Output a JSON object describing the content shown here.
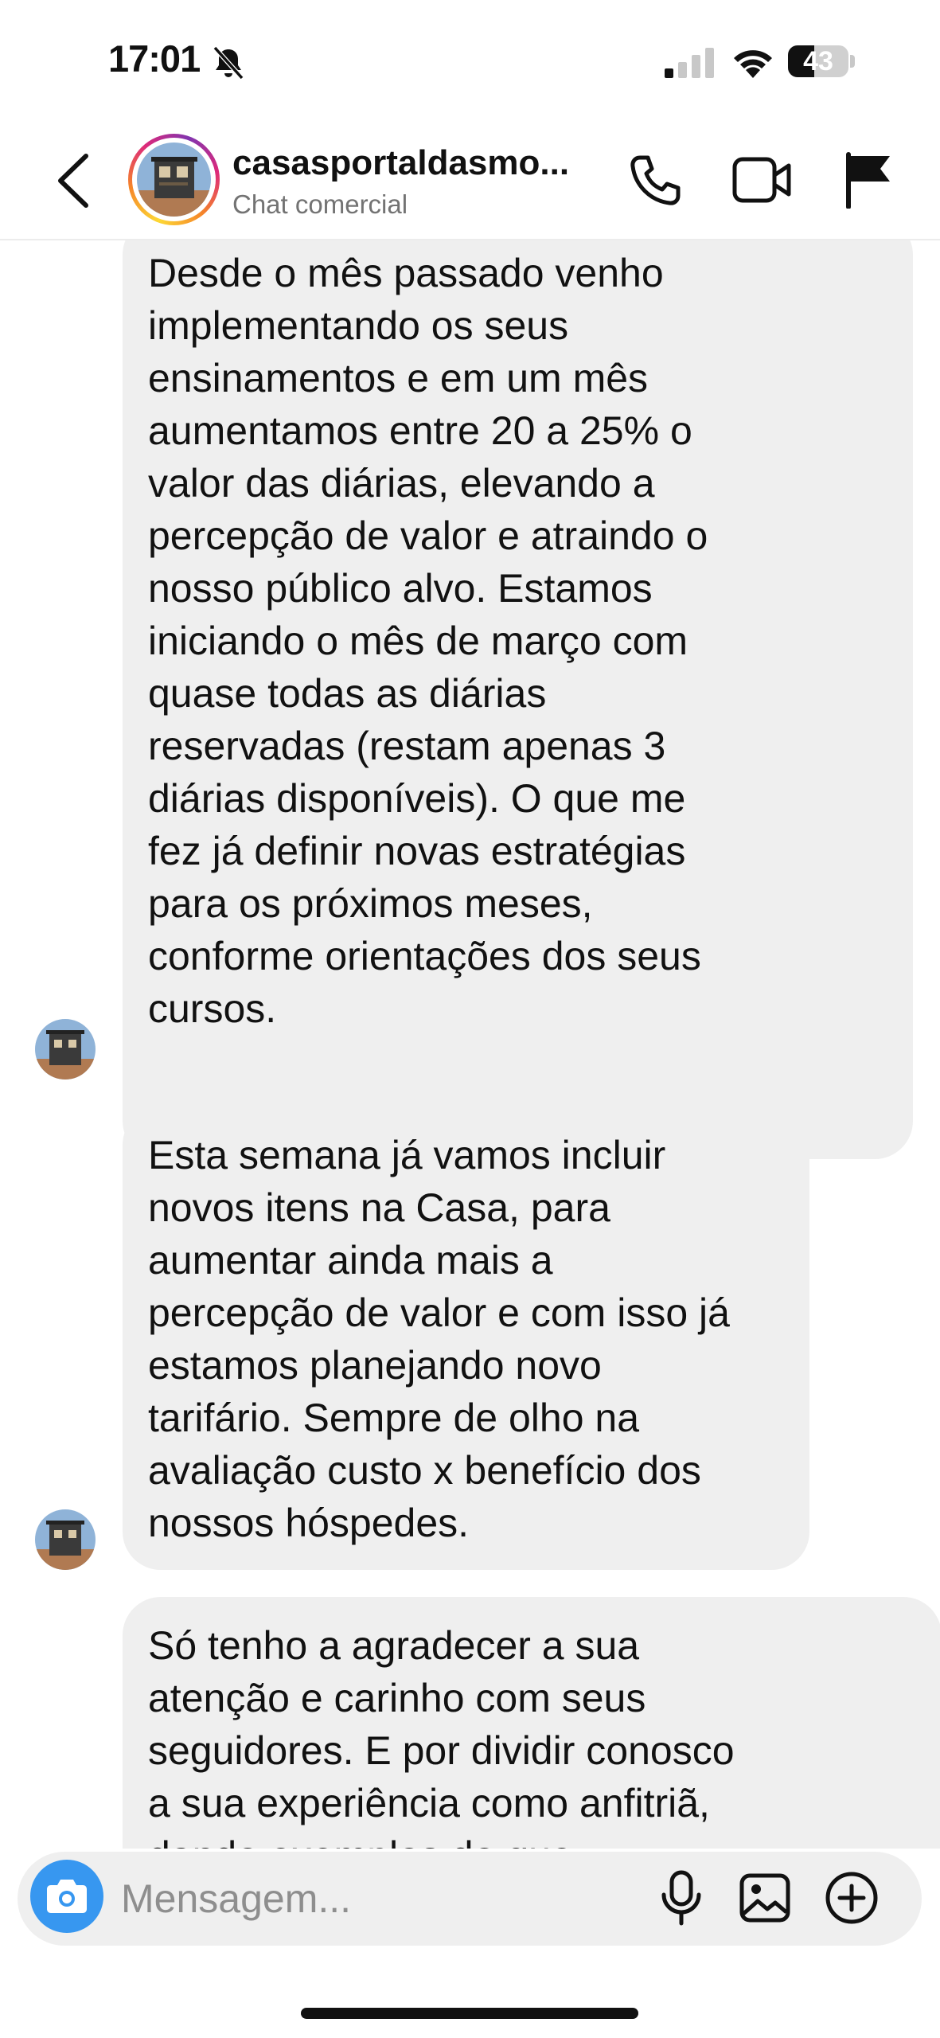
{
  "status_bar": {
    "time": "17:01",
    "battery_percent": 43,
    "battery_label": "43"
  },
  "header": {
    "contact_name": "casasportaldasmo...",
    "subtitle": "Chat comercial",
    "icons": [
      "back-icon",
      "phone-icon",
      "video-camera-icon",
      "flag-icon"
    ]
  },
  "messages": [
    {
      "text": "Desde o mês passado venho\nimplementando os seus\nensinamentos e em um mês\naumentamos entre 20 a 25% o\nvalor das diárias, elevando a\npercepção de valor e atraindo o\nnosso público alvo. Estamos\niniciando o mês de março com\nquase todas as diárias\nreservadas (restam apenas 3\ndiárias disponíveis). O que me\nfez já definir novas estratégias\npara os próximos meses,\nconforme orientações dos seus\ncursos."
    },
    {
      "text": "Esta semana já vamos incluir\nnovos itens na Casa, para\naumentar ainda mais a\npercepção de valor e com isso já\nestamos planejando novo\ntarifário. Sempre de olho na\navaliação custo x benefício dos\nnossos hóspedes."
    },
    {
      "text": "Só tenho a agradecer a sua\natenção e carinho com seus\nseguidores. E por dividir conosco\na sua experiência como anfitriã,\ndando exemplos do que"
    }
  ],
  "composer": {
    "placeholder": "Mensagem...",
    "icons": [
      "camera-icon",
      "microphone-icon",
      "gallery-icon",
      "plus-icon"
    ]
  },
  "colors": {
    "accent_blue": "#3797f0",
    "bubble_bg": "#efefef",
    "subtitle_gray": "#737373"
  }
}
